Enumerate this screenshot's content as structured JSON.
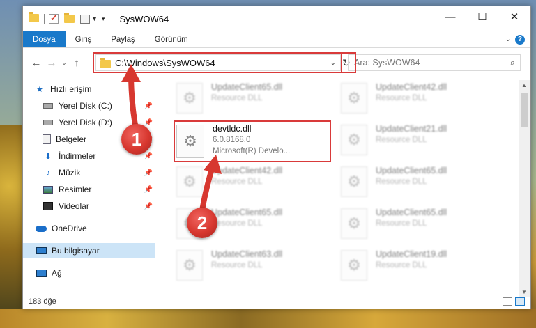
{
  "window": {
    "title": "SysWOW64",
    "controls": {
      "minimize": "—",
      "maximize": "☐",
      "close": "✕"
    }
  },
  "ribbon": {
    "tabs": [
      {
        "label": "Dosya",
        "active": true
      },
      {
        "label": "Giriş",
        "active": false
      },
      {
        "label": "Paylaş",
        "active": false
      },
      {
        "label": "Görünüm",
        "active": false
      }
    ],
    "help": "?"
  },
  "nav": {
    "back": "←",
    "forward": "→",
    "recent": "⌄",
    "up": "↑",
    "address": "C:\\Windows\\SysWOW64",
    "search_placeholder": "Ara: SysWOW64"
  },
  "sidebar": {
    "items": [
      {
        "label": "Hızlı erişim",
        "icon": "star-icon",
        "pinned": false
      },
      {
        "label": "Yerel Disk (C:)",
        "icon": "drive-icon",
        "pinned": true
      },
      {
        "label": "Yerel Disk (D:)",
        "icon": "drive-icon",
        "pinned": true
      },
      {
        "label": "Belgeler",
        "icon": "documents-icon",
        "pinned": true
      },
      {
        "label": "İndirmeler",
        "icon": "download-icon",
        "pinned": true
      },
      {
        "label": "Müzik",
        "icon": "music-icon",
        "pinned": true
      },
      {
        "label": "Resimler",
        "icon": "pictures-icon",
        "pinned": true
      },
      {
        "label": "Videolar",
        "icon": "videos-icon",
        "pinned": true
      },
      {
        "label": "OneDrive",
        "icon": "cloud-icon",
        "pinned": false
      },
      {
        "label": "Bu bilgisayar",
        "icon": "computer-icon",
        "pinned": false,
        "selected": true
      },
      {
        "label": "Ağ",
        "icon": "network-icon",
        "pinned": false
      }
    ],
    "pin_glyph": "📌"
  },
  "files": {
    "selected": {
      "name": "devtldc.dll",
      "version": "6.0.8168.0",
      "company": "Microsoft(R) Develo..."
    },
    "others": [
      {
        "name": "UpdateClient65.dll",
        "type": "Resource DLL"
      },
      {
        "name": "UpdateClient42.dll",
        "type": "Resource DLL"
      },
      {
        "name": "UpdateClient21.dll",
        "type": "Resource DLL"
      },
      {
        "name": "UpdateClient42.dll",
        "type": "Resource DLL"
      },
      {
        "name": "UpdateClient65.dll",
        "type": "Resource DLL"
      },
      {
        "name": "UpdateClient65.dll",
        "type": "Resource DLL"
      },
      {
        "name": "UpdateClient65.dll",
        "type": "Resource DLL"
      },
      {
        "name": "UpdateClient63.dll",
        "type": "Resource DLL"
      },
      {
        "name": "UpdateClient19.dll",
        "type": "Resource DLL"
      }
    ]
  },
  "status": {
    "count": "183 öğe"
  },
  "callouts": [
    {
      "number": "1",
      "color": "#d7372f"
    },
    {
      "number": "2",
      "color": "#d7372f"
    }
  ],
  "colors": {
    "accent": "#1979ca",
    "highlight": "#d93a3a",
    "selection": "#cce4f7"
  }
}
